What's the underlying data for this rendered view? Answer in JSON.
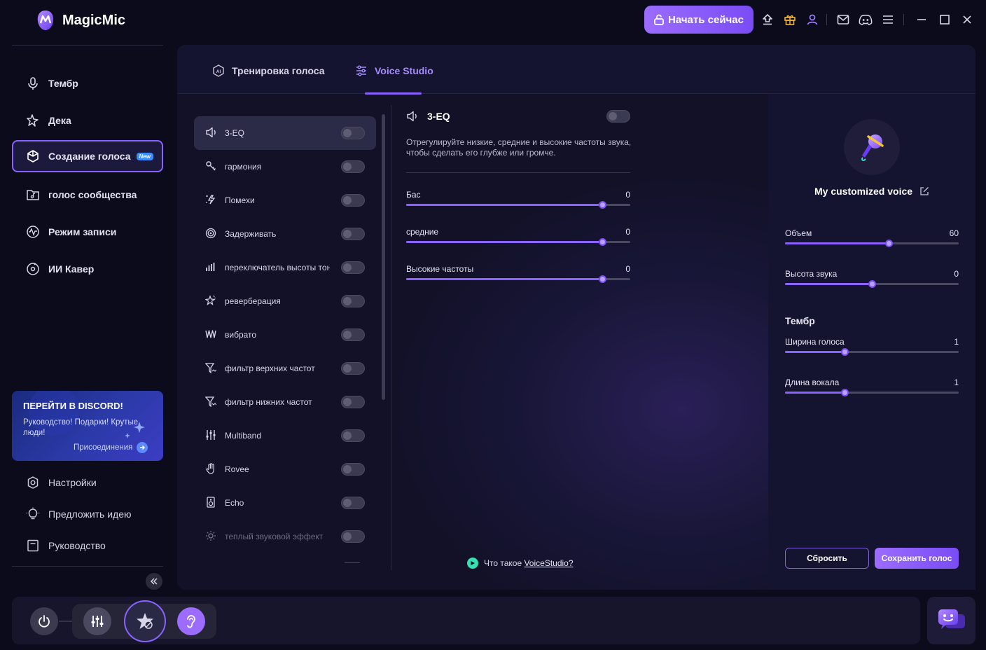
{
  "app": {
    "title": "MagicMic"
  },
  "titlebar": {
    "start_label": "Начать сейчас",
    "icons": [
      "upload-icon",
      "gift-icon",
      "user-icon",
      "mail-icon",
      "discord-icon",
      "menu-icon",
      "minimize-icon",
      "maximize-icon",
      "close-icon"
    ]
  },
  "sidebar": {
    "items": [
      {
        "label": "Тембр",
        "icon": "microphone-icon"
      },
      {
        "label": "Дека",
        "icon": "sparkle-icon"
      },
      {
        "label": "Создание голоса",
        "icon": "cube-icon",
        "badge": "New",
        "active": true
      },
      {
        "label": "голос сообщества",
        "icon": "music-folder-icon"
      },
      {
        "label": "Режим записи",
        "icon": "waveform-icon"
      },
      {
        "label": "ИИ Кавер",
        "icon": "disc-icon"
      }
    ],
    "discord": {
      "title": "ПЕРЕЙТИ В DISCORD!",
      "text": "Руководство! Подарки! Крутые люди!",
      "join": "Присоединения"
    },
    "util": [
      {
        "label": "Настройки",
        "icon": "settings-icon"
      },
      {
        "label": "Предложить идею",
        "icon": "lightbulb-icon"
      },
      {
        "label": "Руководство",
        "icon": "book-icon"
      }
    ]
  },
  "tabs": [
    {
      "label": "Тренировка голоса",
      "icon": "ai-icon"
    },
    {
      "label": "Voice Studio",
      "icon": "sliders-icon",
      "active": true
    }
  ],
  "effects": [
    {
      "label": "3-EQ",
      "icon": "speaker-icon",
      "selected": true,
      "on": false
    },
    {
      "label": "гармония",
      "icon": "key-icon",
      "on": false
    },
    {
      "label": "Помехи",
      "icon": "noise-icon",
      "on": false
    },
    {
      "label": "Задерживать",
      "icon": "delay-icon",
      "on": false
    },
    {
      "label": "переключатель высоты тона",
      "icon": "bars-icon",
      "on": false
    },
    {
      "label": "реверберация",
      "icon": "reverb-icon",
      "on": false
    },
    {
      "label": "вибрато",
      "icon": "vibrato-icon",
      "on": false
    },
    {
      "label": "фильтр верхних частот",
      "icon": "highpass-icon",
      "on": false
    },
    {
      "label": "фильтр нижних частот",
      "icon": "lowpass-icon",
      "on": false
    },
    {
      "label": "Multiband",
      "icon": "multiband-icon",
      "on": false
    },
    {
      "label": "Rovee",
      "icon": "hand-icon",
      "on": false
    },
    {
      "label": "Echo",
      "icon": "echo-icon",
      "on": false
    },
    {
      "label": "теплый звуковой эффект",
      "icon": "sun-icon",
      "on": false,
      "dim": true
    }
  ],
  "detail": {
    "title": "3-EQ",
    "description": "Отрегулируйте низкие, средние и высокие частоты звука, чтобы сделать его глубже или громче.",
    "sliders": [
      {
        "label": "Бас",
        "value": "0",
        "fraction": 0.875
      },
      {
        "label": "средние",
        "value": "0",
        "fraction": 0.875
      },
      {
        "label": "Высокие частоты",
        "value": "0",
        "fraction": 0.875
      }
    ],
    "help_prefix": "Что такое ",
    "help_link": "VoiceStudio?"
  },
  "voice": {
    "name": "My customized voice",
    "sliders": [
      {
        "label": "Объем",
        "value": "60",
        "fraction": 0.595
      },
      {
        "label": "Высота звука",
        "value": "0",
        "fraction": 0.5
      }
    ],
    "timbre_heading": "Тембр",
    "timbre_sliders": [
      {
        "label": "Ширина голоса",
        "value": "1",
        "fraction": 0.343
      },
      {
        "label": "Длина вокала",
        "value": "1",
        "fraction": 0.343
      }
    ],
    "reset_label": "Сбросить",
    "save_label": "Сохранить голос"
  },
  "colors": {
    "accent": "#8b62ff",
    "background": "#0b0b1c",
    "panel": "#151430"
  }
}
